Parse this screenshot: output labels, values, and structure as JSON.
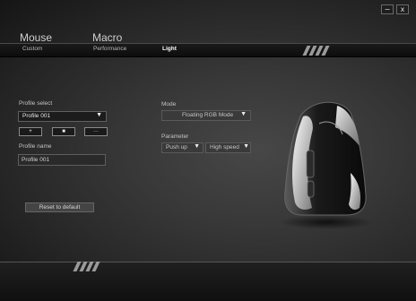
{
  "window": {
    "minimize_label": "−",
    "close_label": "x"
  },
  "tabs": {
    "mouse": "Mouse",
    "macro": "Macro"
  },
  "subtabs": {
    "custom": "Custom",
    "performance": "Performance",
    "light": "Light"
  },
  "profile_select": {
    "label": "Profile select",
    "value": "Profile 001",
    "buttons": {
      "add": "+",
      "delete": "■",
      "more": "···"
    }
  },
  "profile_name": {
    "label": "Profile name",
    "value": "Profile 001"
  },
  "mode": {
    "label": "Mode",
    "value": "Floating RGB Mode"
  },
  "parameter": {
    "label": "Parameter",
    "direction": "Push up",
    "speed": "High speed"
  },
  "reset_label": "Reset to default",
  "colors": {
    "accent": "#ffffff",
    "bg": "#333333",
    "panel": "#1c1c1c"
  }
}
